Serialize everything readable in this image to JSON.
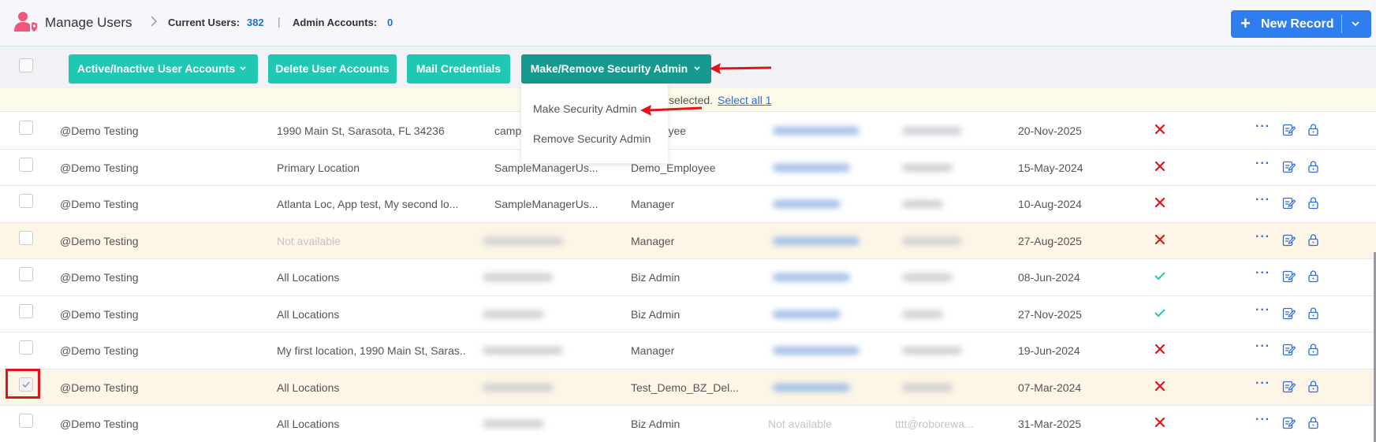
{
  "header": {
    "app_title": "Manage Users",
    "current_users_label": "Current Users:",
    "current_users_value": "382",
    "separator": "|",
    "admin_accounts_label": "Admin Accounts:",
    "admin_accounts_value": "0",
    "new_record_label": "New Record"
  },
  "toolbar": {
    "active_inactive_label": "Active/Inactive User Accounts",
    "delete_label": "Delete User Accounts",
    "mail_label": "Mail Credentials",
    "security_admin_label": "Make/Remove Security Admin"
  },
  "selection_bar": {
    "text": "selected.",
    "select_all_link": "Select all 1"
  },
  "dropdown": {
    "items": [
      "Make Security Admin",
      "Remove Security Admin"
    ]
  },
  "colors": {
    "accent": "#20c7b3",
    "accent_dark": "#16998e",
    "primary": "#2f7ef0",
    "danger": "#e2131b",
    "success": "#20c7b3"
  },
  "rows": [
    {
      "name": "@Demo Testing",
      "location": "1990 Main St, Sarasota, FL 34236",
      "username": "camp",
      "role": "_Employee",
      "date": "20-Nov-2025",
      "status": "x",
      "location_na": false
    },
    {
      "name": "@Demo Testing",
      "location": "Primary Location",
      "username": "SampleManagerUs...",
      "role": "Demo_Employee",
      "date": "15-May-2024",
      "status": "x",
      "location_na": false
    },
    {
      "name": "@Demo Testing",
      "location": "Atlanta Loc, App test, My second lo...",
      "username": "SampleManagerUs...",
      "role": "Manager",
      "date": "10-Aug-2024",
      "status": "x",
      "location_na": false
    },
    {
      "name": "@Demo Testing",
      "location": "Not available",
      "username": "",
      "role": "Manager",
      "date": "27-Aug-2025",
      "status": "x",
      "location_na": true
    },
    {
      "name": "@Demo Testing",
      "location": "All Locations",
      "username": "",
      "role": "Biz Admin",
      "date": "08-Jun-2024",
      "status": "check",
      "location_na": false
    },
    {
      "name": "@Demo Testing",
      "location": "All Locations",
      "username": "",
      "role": "Biz Admin",
      "date": "27-Nov-2025",
      "status": "check",
      "location_na": false
    },
    {
      "name": "@Demo Testing",
      "location": "My first location, 1990 Main St, Saras...",
      "username": "",
      "role": "Manager",
      "date": "19-Jun-2024",
      "status": "x",
      "location_na": false
    },
    {
      "name": "@Demo Testing",
      "location": "All Locations",
      "username": "",
      "role": "Test_Demo_BZ_Del...",
      "date": "07-Mar-2024",
      "status": "x",
      "location_na": false,
      "checked": true
    },
    {
      "name": "@Demo Testing",
      "location": "All Locations",
      "username": "",
      "role": "Biz Admin",
      "email_col": "Not available",
      "email2": "tttt@roborewa...",
      "date": "31-Mar-2025",
      "status": "x",
      "location_na": false
    }
  ],
  "icons": {
    "logo": "user-shield-icon",
    "breadcrumb": "chevron-right-icon",
    "row_more": "more-dots-icon",
    "row_edit": "edit-icon",
    "row_lock": "lock-icon"
  },
  "action_dots": "···"
}
